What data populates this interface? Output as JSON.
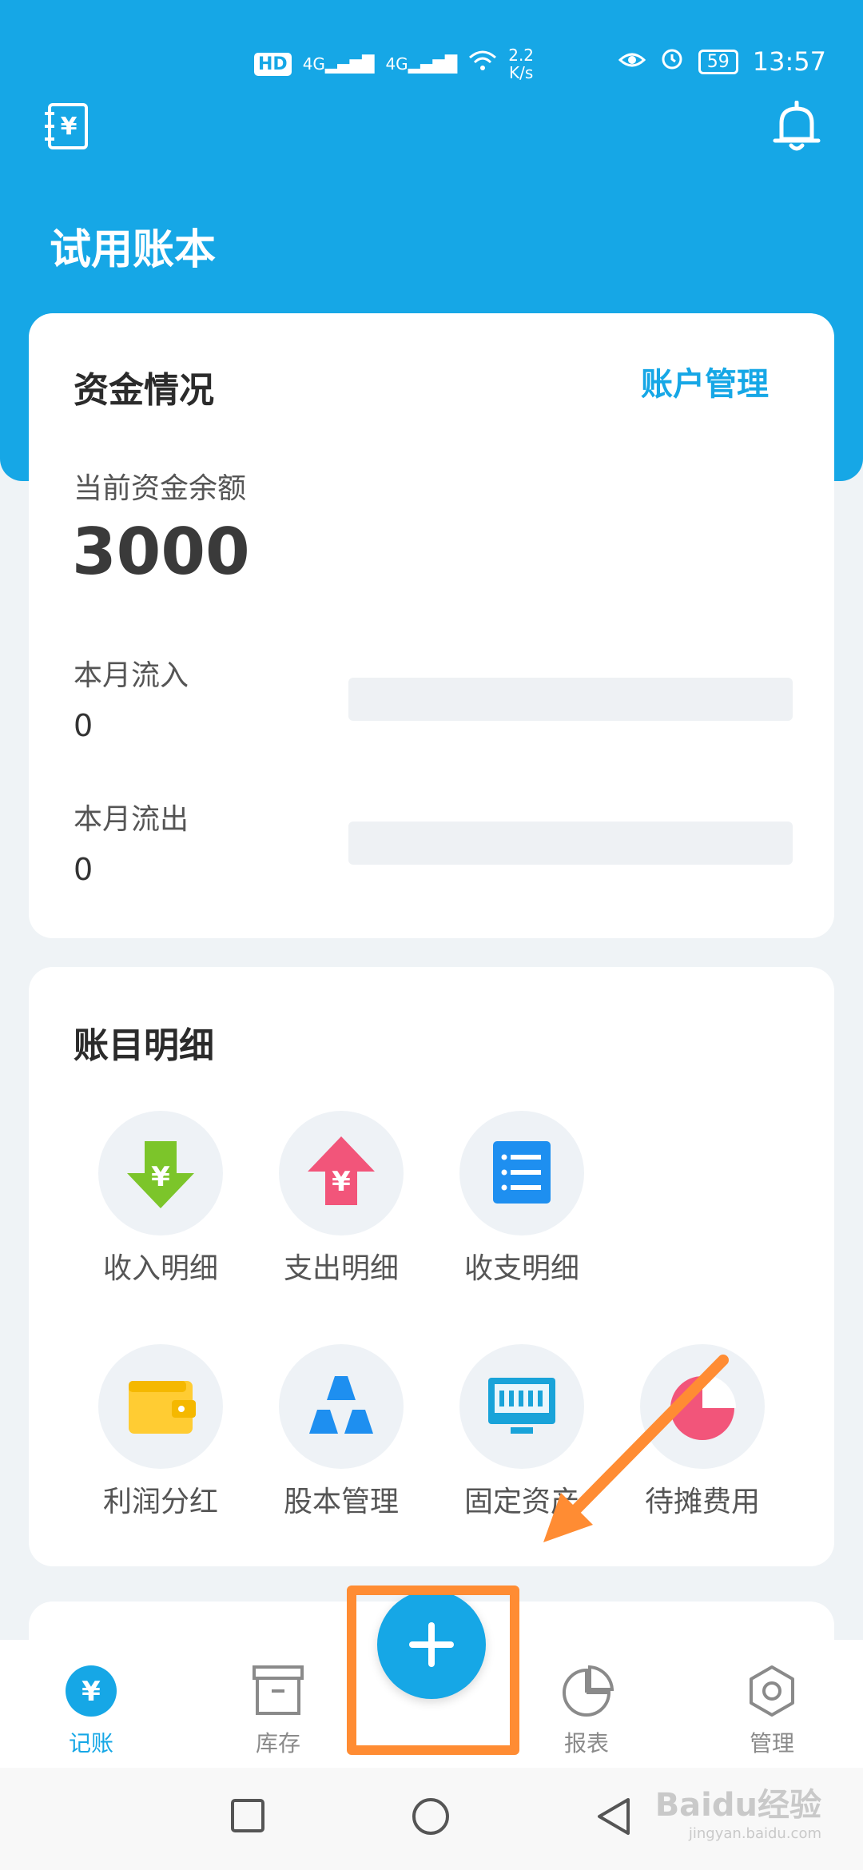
{
  "status_bar": {
    "hd": "HD",
    "sig1": "4G",
    "sig2": "4G",
    "speed_top": "2.2",
    "speed_bottom": "K/s",
    "battery": "59",
    "time": "13:57"
  },
  "header": {
    "ledger_title": "试用账本"
  },
  "funds": {
    "title": "资金情况",
    "account_link": "账户管理",
    "balance_label": "当前资金余额",
    "balance_value": "3000",
    "inflow_label": "本月流入",
    "inflow_value": "0",
    "outflow_label": "本月流出",
    "outflow_value": "0"
  },
  "details": {
    "title": "账目明细",
    "items": [
      {
        "label": "收入明细",
        "icon": "income-arrow-icon"
      },
      {
        "label": "支出明细",
        "icon": "expense-arrow-icon"
      },
      {
        "label": "收支明细",
        "icon": "list-icon"
      },
      {
        "label": "利润分红",
        "icon": "wallet-icon"
      },
      {
        "label": "股本管理",
        "icon": "triangles-icon"
      },
      {
        "label": "固定资产",
        "icon": "monitor-icon"
      },
      {
        "label": "待摊费用",
        "icon": "pie-icon"
      }
    ]
  },
  "nav": {
    "items": [
      {
        "label": "记账",
        "icon": "yen-circle-icon",
        "active": true
      },
      {
        "label": "库存",
        "icon": "archive-box-icon"
      },
      {
        "label": "报表",
        "icon": "pie-chart-icon"
      },
      {
        "label": "管理",
        "icon": "hexagon-gear-icon"
      }
    ]
  },
  "watermark": {
    "text": "Baidu经验",
    "sub": "jingyan.baidu.com"
  },
  "colors": {
    "primary": "#16a7e6",
    "income": "#7cc52a",
    "expense": "#f2557a",
    "list": "#1e8ff0",
    "wallet": "#ffcc33",
    "highlight": "#ff8c33"
  }
}
